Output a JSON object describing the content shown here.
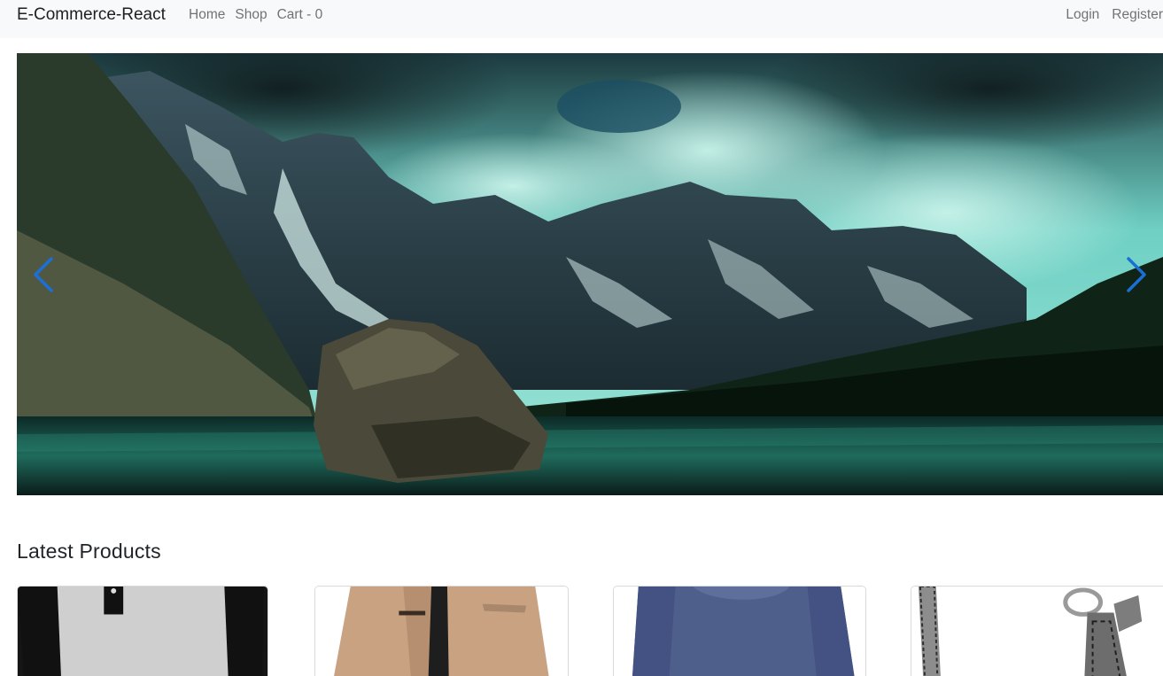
{
  "navbar": {
    "brand": "E-Commerce-React",
    "links": [
      "Home",
      "Shop",
      "Cart - 0"
    ],
    "auth": [
      "Login",
      "Register"
    ]
  },
  "carousel": {
    "slide_image": "mountain-lake-landscape",
    "prev_icon": "chevron-left-icon",
    "next_icon": "chevron-right-icon",
    "control_color": "#1a6fd8"
  },
  "latest": {
    "title": "Latest Products",
    "products": [
      {
        "image": "raglan-henley-shirt"
      },
      {
        "image": "tan-jacket"
      },
      {
        "image": "blue-long-sleeve-shirt"
      },
      {
        "image": "silver-chain-bracelet"
      }
    ]
  }
}
